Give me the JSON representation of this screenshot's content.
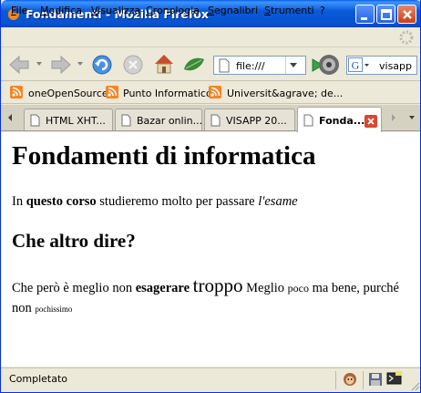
{
  "window": {
    "title": "Fondamenti - Mozilla Firefox"
  },
  "menu": [
    "File",
    "Modifica",
    "Visualizza",
    "Cronologia",
    "Segnalibri",
    "Strumenti",
    "?"
  ],
  "nav": {
    "url": "file:///",
    "search_value": "visapp",
    "search_engine_badge": "G"
  },
  "bookmarks": [
    "oneOpenSource",
    "Punto Informatico",
    "Universit&agrave; de..."
  ],
  "tabs": [
    "HTML XHT...",
    "Bazar onlin...",
    "VISAPP 20...",
    "Fonda..."
  ],
  "page": {
    "h1": "Fondamenti di informatica",
    "p1": {
      "t1": "In ",
      "b1": "questo corso",
      "t2": " studieremo molto per passare ",
      "i1": "l'esame"
    },
    "h2": "Che altro dire?",
    "p2": {
      "t1": "Che però è meglio non ",
      "b1": "esagerare",
      "big": "troppo",
      "t2": " Meglio ",
      "small": "poco",
      "t3": " ma bene, purché non ",
      "tiny": "pochissimo"
    }
  },
  "status": {
    "text": "Completato"
  },
  "colors": {
    "titlebar": "#0a5ad8",
    "rss": "#f78422",
    "close": "#d64830",
    "go": "#3aa34a"
  }
}
